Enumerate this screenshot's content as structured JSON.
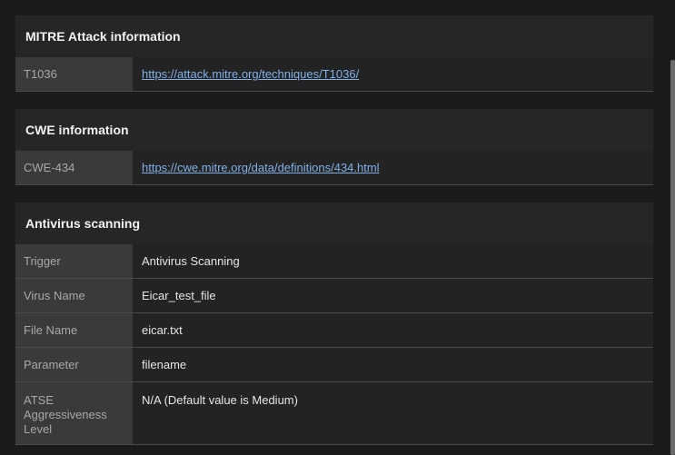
{
  "mitre": {
    "title": "MITRE Attack information",
    "technique_id": "T1036",
    "technique_url": "https://attack.mitre.org/techniques/T1036/"
  },
  "cwe": {
    "title": "CWE information",
    "cwe_id": "CWE-434",
    "cwe_url": "https://cwe.mitre.org/data/definitions/434.html"
  },
  "antivirus": {
    "title": "Antivirus scanning",
    "rows": [
      {
        "key": "Trigger",
        "value": "Antivirus Scanning"
      },
      {
        "key": "Virus Name",
        "value": "Eicar_test_file"
      },
      {
        "key": "File Name",
        "value": "eicar.txt"
      },
      {
        "key": "Parameter",
        "value": "filename"
      },
      {
        "key": "ATSE Aggressiveness Level",
        "value": "N/A (Default value is Medium)"
      }
    ]
  },
  "colors": {
    "background": "#1b1b1b",
    "panel": "#252525",
    "key_cell": "#3a3a3a",
    "link": "#7fb0e8"
  }
}
